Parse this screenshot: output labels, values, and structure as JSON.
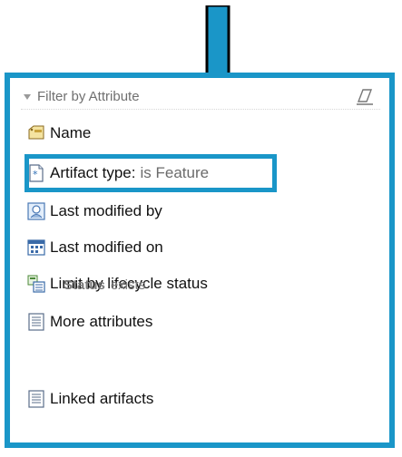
{
  "panel": {
    "title": "Filter by Attribute",
    "items": [
      {
        "label": "Name",
        "icon": "name-tag-icon"
      },
      {
        "label": "Artifact type:",
        "value": "is Feature",
        "icon": "artifact-type-icon"
      },
      {
        "label": "Last modified by",
        "icon": "user-search-icon"
      },
      {
        "label": "Last modified on",
        "icon": "calendar-icon"
      },
      {
        "label": "Limit by lifecycle status",
        "icon": "lifecycle-icon"
      },
      {
        "label": "More attributes",
        "icon": "list-document-icon"
      },
      {
        "label": "Linked artifacts",
        "icon": "list-document-icon"
      }
    ],
    "status": {
      "label": "Status",
      "value": "exists"
    }
  },
  "colors": {
    "accent": "#1a96c8",
    "header_text": "#707070",
    "value_text": "#6b6b6b"
  }
}
